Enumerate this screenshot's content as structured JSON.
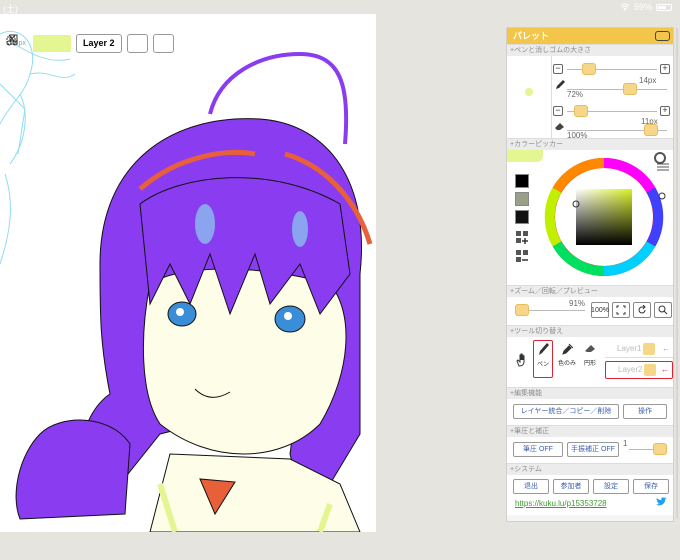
{
  "status_bar": {
    "day": "(土)",
    "battery": "59%"
  },
  "toolbar": {
    "brush_size": "14px",
    "current_color": "#e3f691",
    "layer_label": "Layer 2"
  },
  "palette": {
    "title": "パレット",
    "sections": {
      "pen_size": "+ペンと消しゴムの大きさ",
      "color_picker": "+カラーピッカー",
      "zoom": "+ズーム／回転／プレビュー",
      "tool_switch": "+ツール切り替え",
      "edit": "+編集機能",
      "pressure": "+筆圧と補正",
      "system": "+システム"
    },
    "pen_size_value": "14px",
    "pen_opacity": "72%",
    "eraser_size_value": "11px",
    "eraser_opacity": "100%",
    "zoom_value": "91%",
    "zoom_100_label": "100%",
    "tools": {
      "pen_label": "ペン",
      "eyedropper_label": "色のみ",
      "eraser_label": "円形",
      "layer1_label": "Layer1",
      "layer2_label": "Layer2"
    },
    "edit": {
      "merge_label": "レイヤー統合／コピー／削除",
      "ops_label": "操作"
    },
    "pressure": {
      "pressure_label": "筆圧 OFF",
      "stabilizer_label": "手振補正 OFF",
      "stabilizer_value": "1"
    },
    "system": {
      "leave_label": "退出",
      "members_label": "参加者",
      "settings_label": "設定",
      "save_label": "保存",
      "link_text": "https://kuku.lu/p15353728"
    },
    "picker_swatches": [
      "#000000",
      "#9aa088",
      "#111111"
    ]
  },
  "colors": {
    "accent": "#f3c548",
    "hair": "#8a3cf0",
    "skin": "#fefde8",
    "highlight": "#e3f691"
  }
}
